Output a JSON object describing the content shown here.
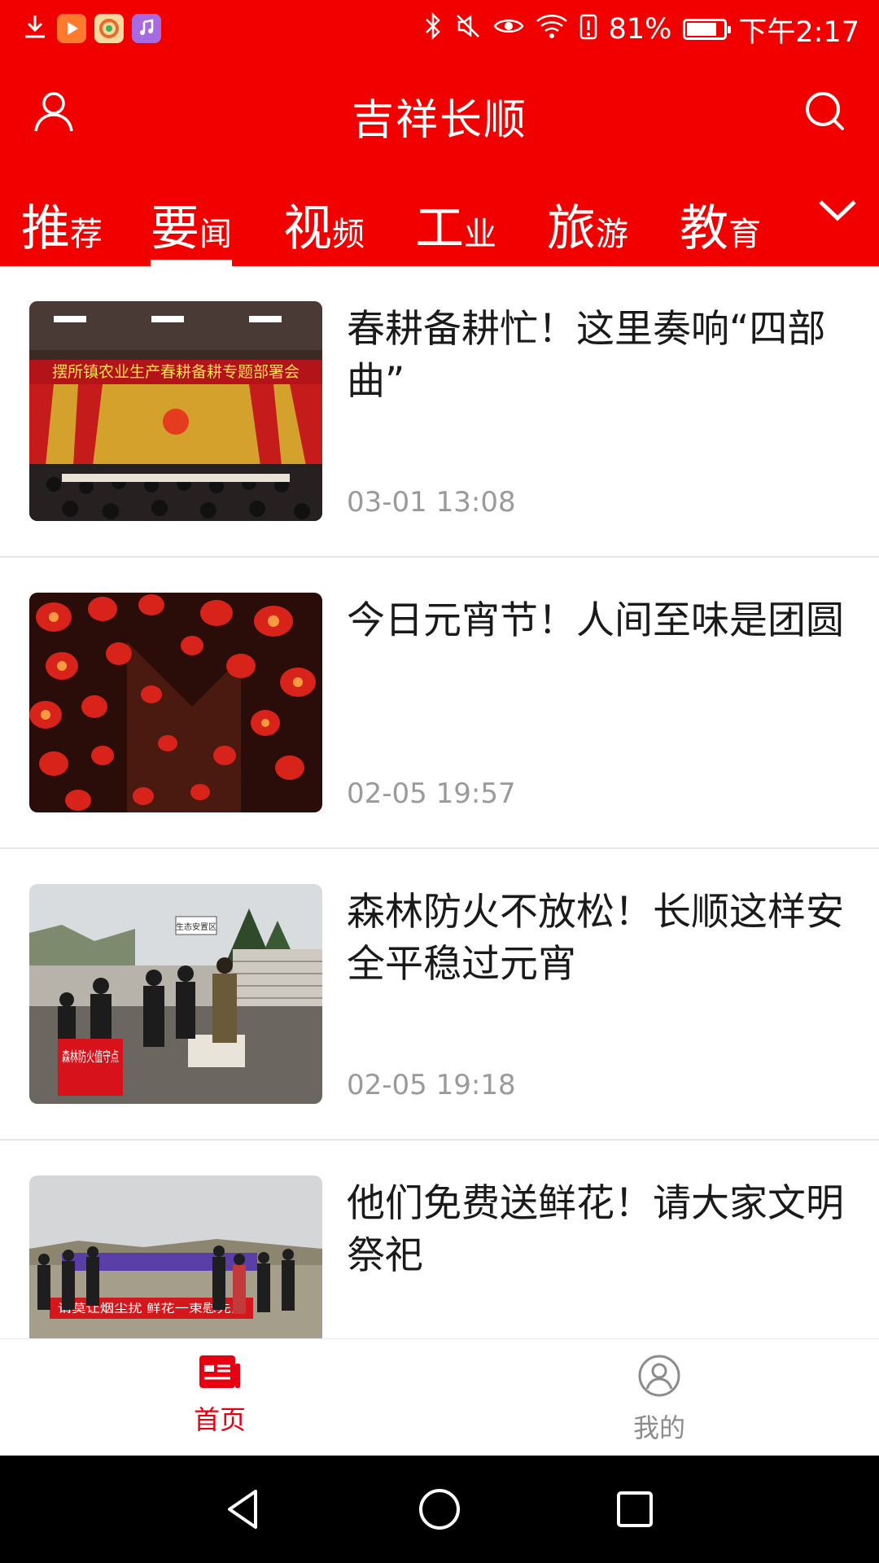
{
  "status_bar": {
    "battery": "81%",
    "battery_level": 0.81,
    "time": "下午2:17",
    "icons": [
      "download-icon",
      "video-app-icon",
      "browser-app-icon",
      "music-app-icon",
      "bluetooth-icon",
      "mute-icon",
      "eye-icon",
      "wifi-icon",
      "battery-alert-icon",
      "battery-icon"
    ]
  },
  "header": {
    "title": "吉祥长顺"
  },
  "tabs": [
    {
      "big": "推",
      "small": "荐"
    },
    {
      "big": "要",
      "small": "闻"
    },
    {
      "big": "视",
      "small": "频"
    },
    {
      "big": "工",
      "small": "业"
    },
    {
      "big": "旅",
      "small": "游"
    },
    {
      "big": "教",
      "small": "育"
    }
  ],
  "active_tab": "要闻",
  "news": [
    {
      "title": "春耕备耕忙！这里奏响“四部曲”",
      "time": "03-01 13:08",
      "banner": "摆所镇农业生产春耕备耕专题部署会"
    },
    {
      "title": "今日元宵节！人间至味是团圆",
      "time": "02-05 19:57"
    },
    {
      "title": "森林防火不放松！长顺这样安全平稳过元宵",
      "time": "02-05 19:18",
      "sign": "森林防火值守点",
      "small_sign": "生态安置区"
    },
    {
      "title": "他们免费送鲜花！请大家文明祭祀",
      "time": "",
      "banner": "请莫让烟尘扰 鲜花一束慰先人"
    }
  ],
  "bottom_nav": {
    "home": "首页",
    "mine": "我的"
  },
  "colors": {
    "brand_red": "#f20000",
    "active_nav": "#e60012",
    "inactive_nav": "#8c8c8c",
    "time_gray": "#9a9a9a"
  }
}
